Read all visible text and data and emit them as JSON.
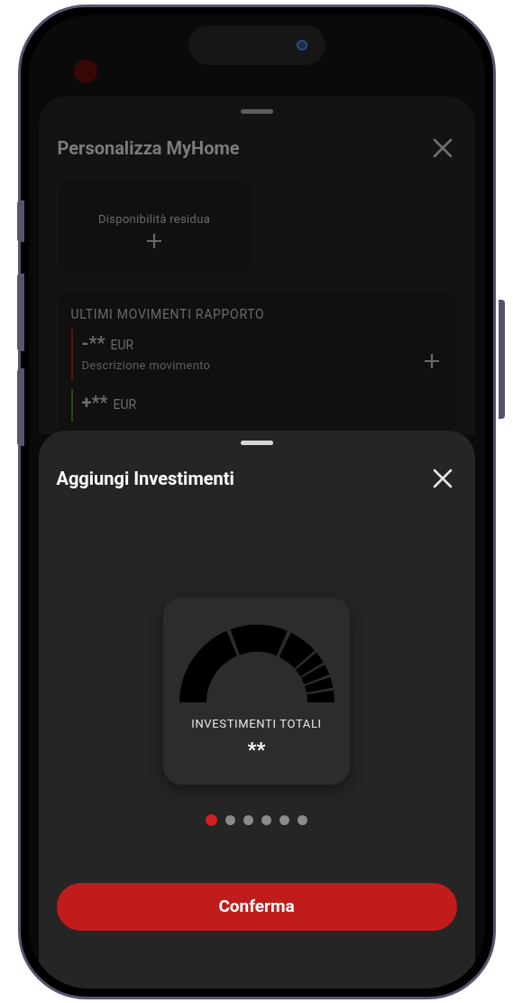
{
  "background_sheet": {
    "title": "Personalizza MyHome",
    "widget": {
      "label": "Disponibilità residua"
    },
    "movements": {
      "title": "ULTIMI MOVIMENTI RAPPORTO",
      "items": [
        {
          "kind": "debit",
          "amount": "-**",
          "currency": "EUR",
          "description": "Descrizione movimento"
        },
        {
          "kind": "credit",
          "amount": "+**",
          "currency": "EUR"
        }
      ]
    }
  },
  "sheet": {
    "title": "Aggiungi Investimenti",
    "card": {
      "label": "INVESTIMENTI TOTALI",
      "value": "**"
    },
    "pages": [
      {
        "selected": true
      },
      {
        "selected": false
      },
      {
        "selected": false
      },
      {
        "selected": false
      },
      {
        "selected": false
      },
      {
        "selected": false
      }
    ],
    "button": "Conferma"
  }
}
